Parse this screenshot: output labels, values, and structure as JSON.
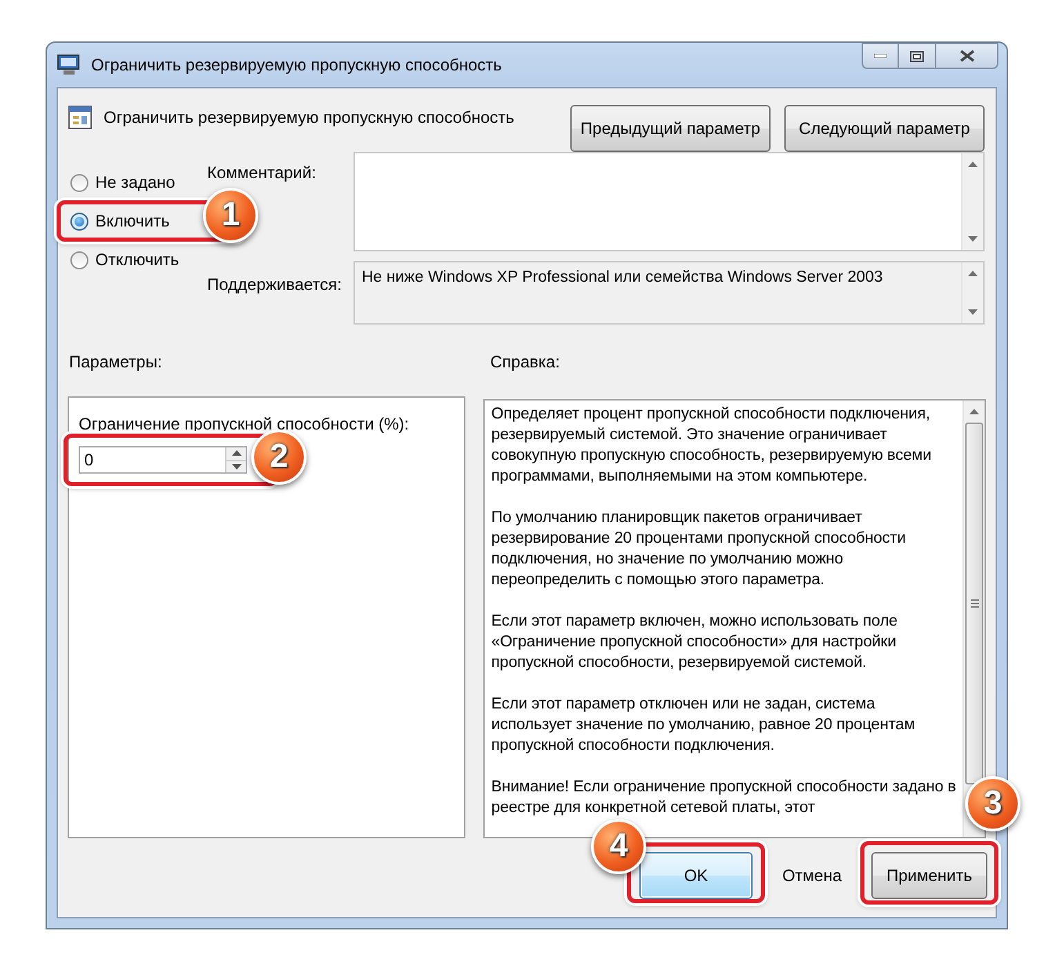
{
  "window": {
    "title": "Ограничить резервируемую пропускную способность"
  },
  "policy": {
    "title": "Ограничить резервируемую пропускную способность"
  },
  "nav_buttons": [
    "Предыдущий параметр",
    "Следующий параметр"
  ],
  "state_options": [
    {
      "label": "Не задано",
      "selected": false
    },
    {
      "label": "Включить",
      "selected": true,
      "callout": "1"
    },
    {
      "label": "Отключить",
      "selected": false
    }
  ],
  "comment": {
    "label": "Комментарий:"
  },
  "supported": {
    "label": "Поддерживается:",
    "value": "Не ниже Windows XP Professional или семейства Windows Server 2003"
  },
  "options_panel": {
    "label": "Параметры:",
    "setting_label": "Ограничение пропускной способности (%):",
    "value": "0",
    "callout": "2"
  },
  "help_panel": {
    "label": "Справка:",
    "paragraphs": [
      "Определяет процент пропускной способности подключения, резервируемый системой. Это значение ограничивает совокупную пропускную способность, резервируемую всеми программами, выполняемыми на этом компьютере.",
      "По умолчанию планировщик пакетов ограничивает резервирование 20 процентами пропускной способности подключения, но значение по умолчанию можно переопределить с помощью этого параметра.",
      "Если этот параметр включен, можно использовать поле «Ограничение пропускной способности» для настройки пропускной способности, резервируемой системой.",
      "Если этот параметр отключен или не задан, система использует значение по умолчанию, равное 20 процентам пропускной способности подключения.",
      "Внимание! Если ограничение пропускной способности задано в реестре для конкретной сетевой платы, этот"
    ]
  },
  "buttons": [
    {
      "label": "OK",
      "kind": "default",
      "callout": "4"
    },
    {
      "label": "Отмена",
      "kind": "flat"
    },
    {
      "label": "Применить",
      "kind": "normal",
      "callout": "3"
    }
  ]
}
